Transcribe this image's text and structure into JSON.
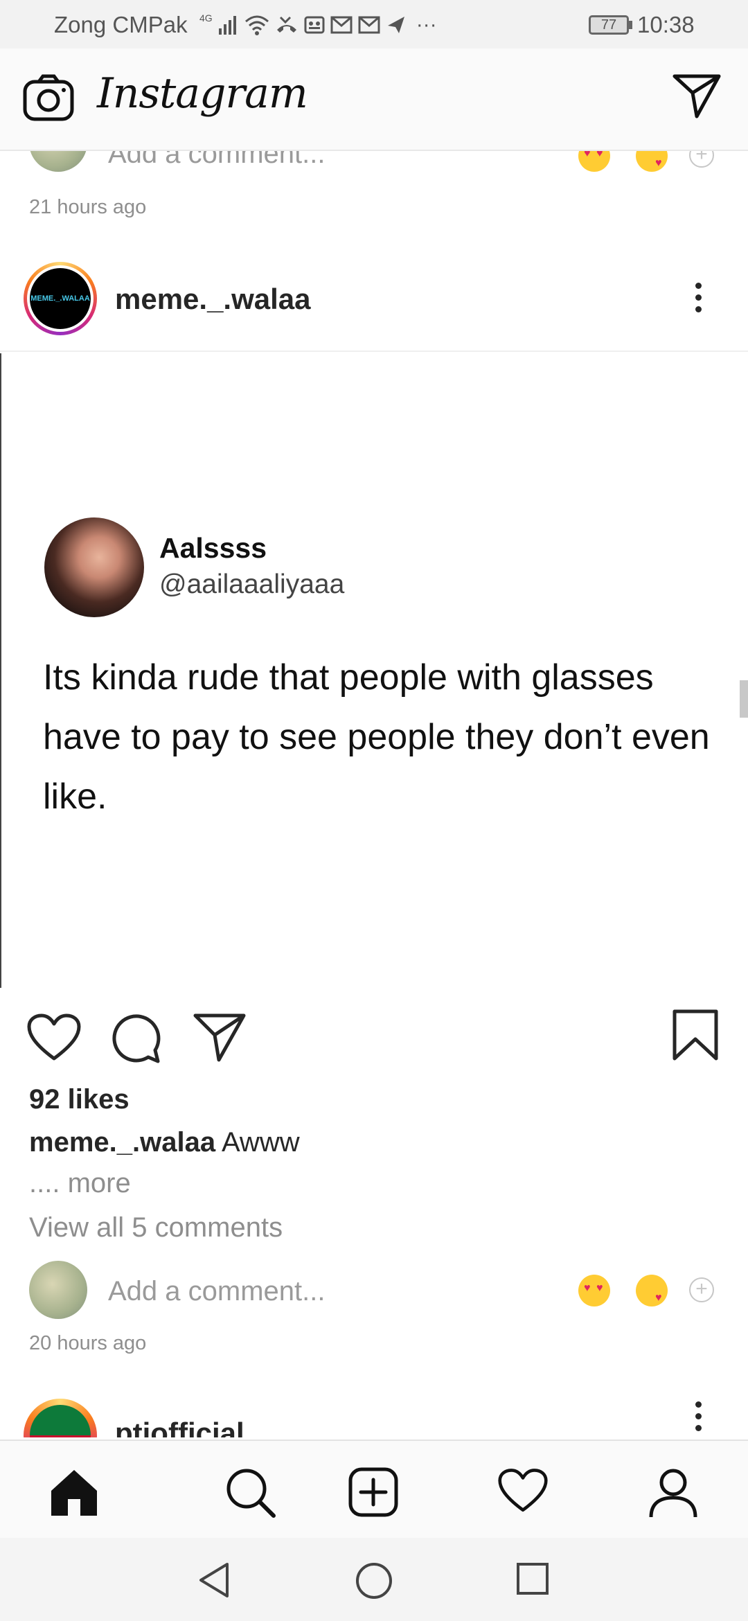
{
  "status_bar": {
    "carrier": "Zong CMPak",
    "network": "4G",
    "battery": "77",
    "time": "10:38"
  },
  "header": {
    "logo": "Instagram"
  },
  "previous_post": {
    "add_comment_placeholder": "Add a comment...",
    "timestamp": "21 hours ago"
  },
  "post": {
    "username": "meme._.walaa",
    "avatar_text": "MEME._.WALAA",
    "tweet": {
      "name": "Aalssss",
      "handle": "@aailaaaliyaaa",
      "text": "Its kinda rude that people with glasses have to pay to see people they don’t even like."
    },
    "likes": "92 likes",
    "caption_user": "meme._.walaa",
    "caption_text": " Awww",
    "more": ".... more",
    "view_comments": "View all 5 comments",
    "add_comment_placeholder": "Add a comment...",
    "timestamp": "20 hours ago"
  },
  "next_post": {
    "username": "ptiofficial"
  },
  "colors": {
    "ig_gradient": [
      "#feda75",
      "#fa7e1e",
      "#d62976",
      "#962fbf"
    ],
    "muted_text": "#8e8e8e"
  }
}
